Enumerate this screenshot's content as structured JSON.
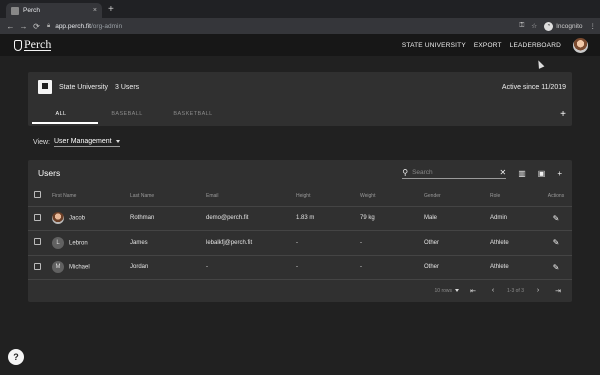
{
  "browser": {
    "tab_title": "Perch",
    "tab_close": "×",
    "new_tab": "+",
    "url_host": "app.perch.fit",
    "url_path": "/org-admin",
    "incognito_label": "Incognito",
    "back_icon": "arrow-left",
    "forward_icon": "arrow-right",
    "reload_icon": "reload"
  },
  "app": {
    "logo_text": "Perch",
    "nav": [
      "STATE UNIVERSITY",
      "EXPORT",
      "LEADERBOARD"
    ]
  },
  "org": {
    "name": "State University",
    "users_count": "3 Users",
    "active_since": "Active since 11/2019",
    "tabs": [
      "ALL",
      "BASEBALL",
      "BASKETBALL"
    ],
    "add": "+"
  },
  "view": {
    "label": "View:",
    "selected": "User Management"
  },
  "users": {
    "title": "Users",
    "search_placeholder": "Search",
    "columns": [
      "First Name",
      "Last Name",
      "Email",
      "Height",
      "Weight",
      "Gender",
      "Role",
      "Actions"
    ],
    "rows": [
      {
        "initial": "",
        "first": "Jacob",
        "last": "Rothman",
        "email": "demo@perch.fit",
        "height": "1.83 m",
        "weight": "79 kg",
        "gender": "Male",
        "role": "Admin"
      },
      {
        "initial": "L",
        "first": "Lebron",
        "last": "James",
        "email": "lebalkfj@perch.fit",
        "height": "-",
        "weight": "-",
        "gender": "Other",
        "role": "Athlete"
      },
      {
        "initial": "M",
        "first": "Michael",
        "last": "Jordan",
        "email": "-",
        "height": "-",
        "weight": "-",
        "gender": "Other",
        "role": "Athlete"
      }
    ],
    "pager": {
      "rows_label": "10 rows",
      "range": "1-3 of 3"
    }
  },
  "help": "?"
}
